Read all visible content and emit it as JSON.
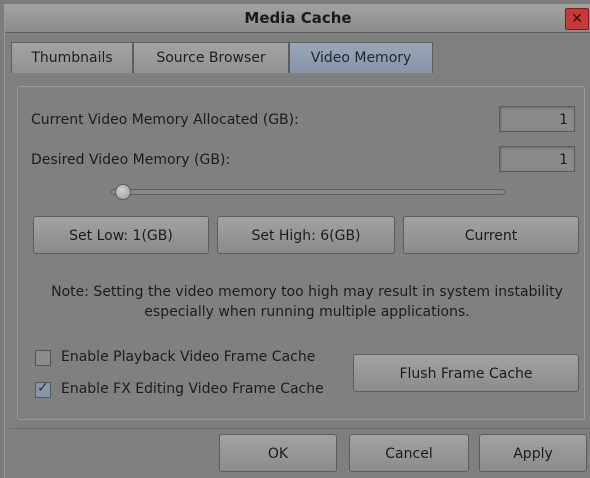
{
  "window": {
    "title": "Media Cache",
    "close_label": "✕"
  },
  "tabs": [
    {
      "label": "Thumbnails"
    },
    {
      "label": "Source Browser"
    },
    {
      "label": "Video Memory"
    }
  ],
  "active_tab": "Video Memory",
  "video_memory": {
    "current_label": "Current Video Memory Allocated (GB):",
    "current_value": "1",
    "desired_label": "Desired Video Memory (GB):",
    "desired_value": "1",
    "slider_value": 0.0
  },
  "buttons": {
    "set_low": "Set Low: 1(GB)",
    "set_high": "Set High: 6(GB)",
    "current": "Current",
    "flush": "Flush Frame Cache",
    "ok": "OK",
    "cancel": "Cancel",
    "apply": "Apply"
  },
  "note": {
    "line1": "Note: Setting the video memory too high may result in system instability",
    "line2": "especially when running multiple applications."
  },
  "options": {
    "playback_cache_label": "Enable Playback Video Frame Cache",
    "playback_cache_checked": false,
    "fx_cache_label": "Enable FX Editing Video Frame Cache",
    "fx_cache_checked": true
  },
  "colors": {
    "active_tab": "#8c99ad",
    "background": "#7f7f7f",
    "close": "#c83a3a"
  }
}
